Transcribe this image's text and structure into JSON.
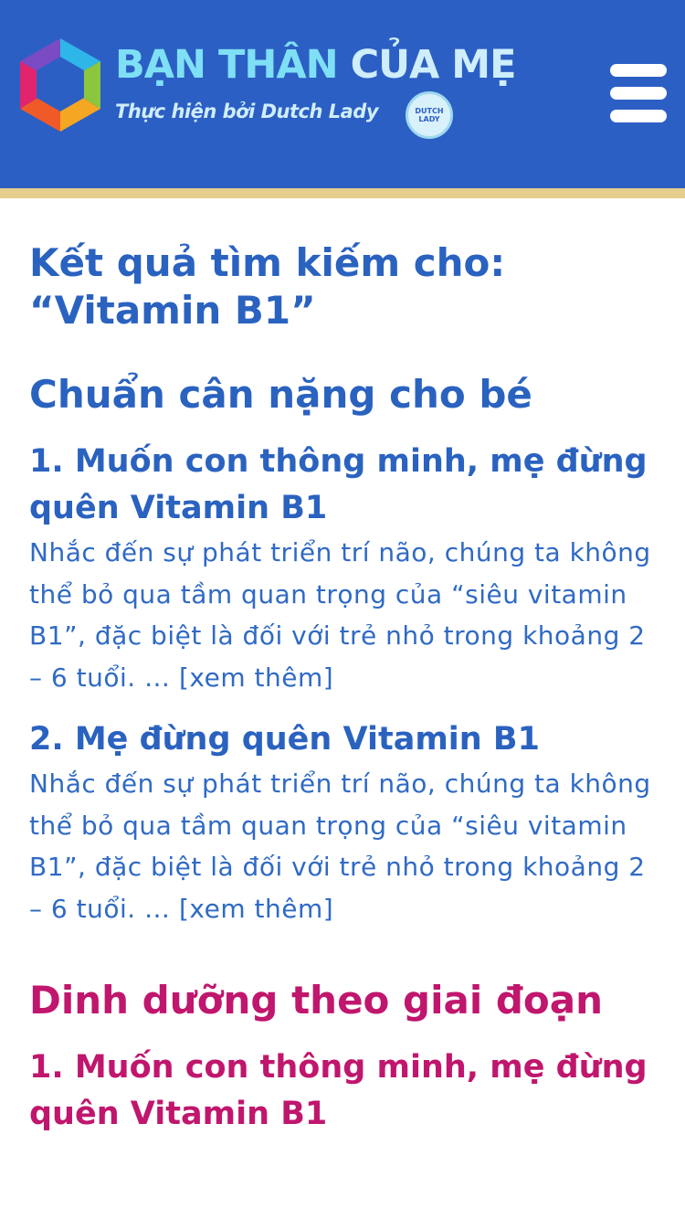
{
  "header": {
    "brand_title_part1": "BẠN THÂN ",
    "brand_title_part2": "CỦA MẸ",
    "brand_subtitle": "Thực hiện bởi Dutch Lady",
    "badge_text": "DUTCH LADY",
    "background_color": "#2c5fc4",
    "stripe_color": "#e6cf8e",
    "menu_icon": "hamburger-menu-icon",
    "logo_icon": "rainbow-hexagon-logo"
  },
  "search": {
    "heading_line1": "Kết quả tìm kiếm cho:",
    "heading_line2": "“Vitamin B1”"
  },
  "sections": [
    {
      "title": "Chuẩn cân nặng cho bé",
      "color": "#2a62c0",
      "articles": [
        {
          "title": "1. Muốn con thông minh, mẹ đừng quên Vitamin B1",
          "excerpt": "Nhắc đến sự phát triển trí não, chúng ta không thể bỏ qua tầm quan trọng của “siêu vitamin B1”, đặc biệt là đối với trẻ nhỏ trong khoảng 2 – 6 tuổi. …",
          "read_more": "[xem thêm]"
        },
        {
          "title": "2. Mẹ đừng quên Vitamin B1",
          "excerpt": "Nhắc đến sự phát triển trí não, chúng ta không thể bỏ qua tầm quan trọng của “siêu vitamin B1”, đặc biệt là đối với trẻ nhỏ trong khoảng 2 – 6 tuổi. …",
          "read_more": "[xem thêm]"
        }
      ]
    },
    {
      "title": "Dinh dưỡng theo giai đoạn",
      "color": "#c0166d",
      "articles": [
        {
          "title": "1. Muốn con thông minh, mẹ đừng quên Vitamin B1"
        }
      ]
    }
  ]
}
